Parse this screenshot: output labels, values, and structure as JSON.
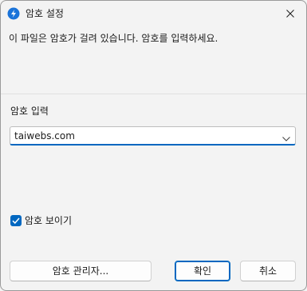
{
  "dialog": {
    "title": "암호 설정",
    "message": "이 파일은 암호가 걸려 있습니다. 암호를 입력하세요.",
    "password_label": "암호 입력",
    "password_value": "taiwebs.com",
    "show_password_label": "암호 보이기",
    "show_password_checked": true,
    "buttons": {
      "manager": "암호 관리자...",
      "ok": "확인",
      "cancel": "취소"
    }
  },
  "colors": {
    "accent": "#0067c0",
    "background": "#f3f3f3"
  },
  "icons": {
    "app": "app-logo-icon",
    "close": "close-icon",
    "dropdown": "chevron-down-icon",
    "check": "checkmark-icon"
  }
}
